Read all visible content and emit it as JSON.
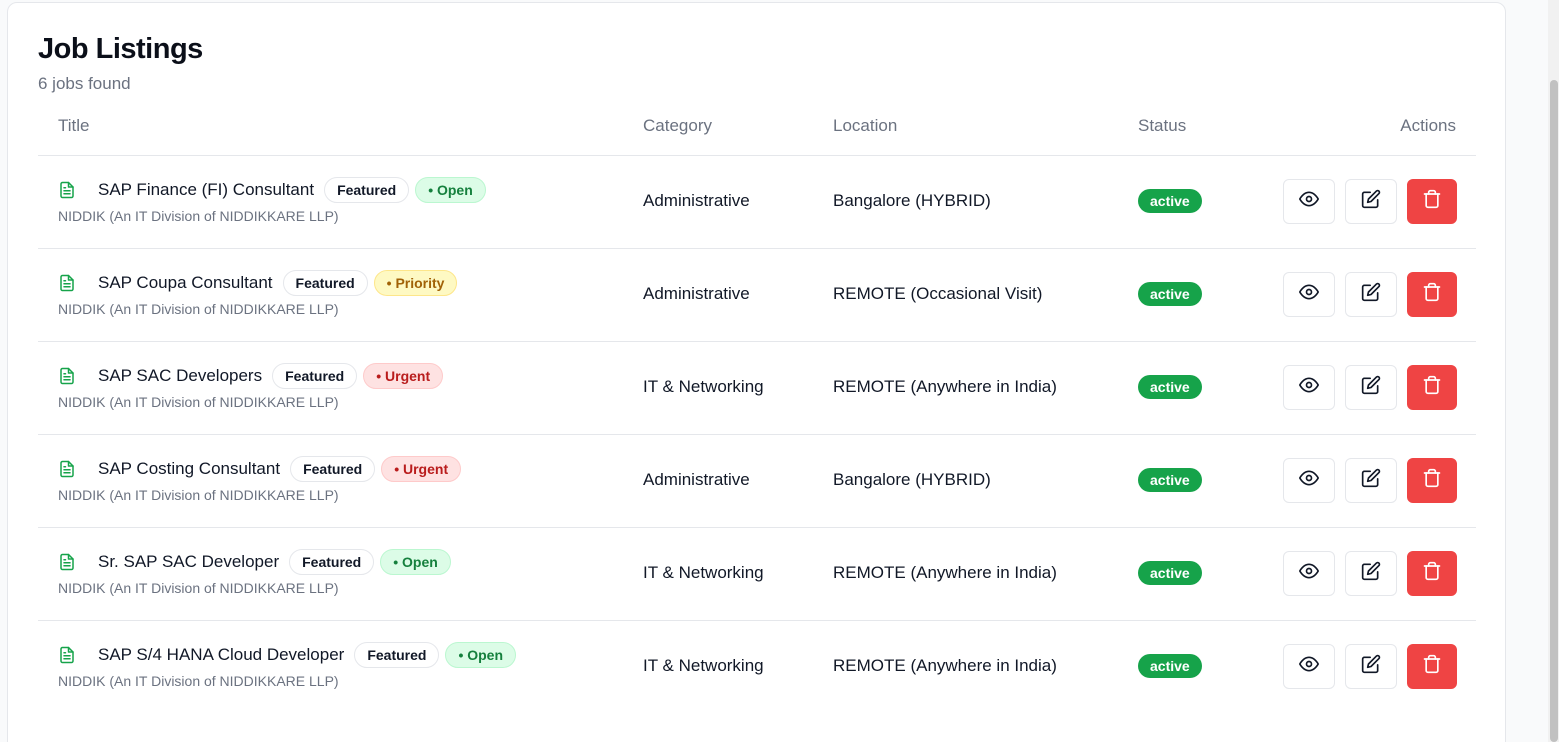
{
  "header": {
    "title": "Job Listings",
    "subtitle": "6 jobs found"
  },
  "columns": {
    "title": "Title",
    "category": "Category",
    "location": "Location",
    "status": "Status",
    "actions": "Actions"
  },
  "colors": {
    "status_active": "#16a34a",
    "delete": "#ef4444",
    "doc_icon": "#16a34a"
  },
  "jobs": [
    {
      "title": "SAP Finance (FI) Consultant",
      "featured": "Featured",
      "tag": "• Open",
      "tag_kind": "open",
      "company": "NIDDIK (An IT Division of NIDDIKKARE LLP)",
      "category": "Administrative",
      "location": "Bangalore (HYBRID)",
      "status": "active"
    },
    {
      "title": "SAP Coupa Consultant",
      "featured": "Featured",
      "tag": "• Priority",
      "tag_kind": "priority",
      "company": "NIDDIK (An IT Division of NIDDIKKARE LLP)",
      "category": "Administrative",
      "location": "REMOTE (Occasional Visit)",
      "status": "active"
    },
    {
      "title": "SAP SAC Developers",
      "featured": "Featured",
      "tag": "• Urgent",
      "tag_kind": "urgent",
      "company": "NIDDIK (An IT Division of NIDDIKKARE LLP)",
      "category": "IT & Networking",
      "location": "REMOTE (Anywhere in India)",
      "status": "active"
    },
    {
      "title": "SAP Costing Consultant",
      "featured": "Featured",
      "tag": "• Urgent",
      "tag_kind": "urgent",
      "company": "NIDDIK (An IT Division of NIDDIKKARE LLP)",
      "category": "Administrative",
      "location": "Bangalore (HYBRID)",
      "status": "active"
    },
    {
      "title": "Sr. SAP SAC Developer",
      "featured": "Featured",
      "tag": "• Open",
      "tag_kind": "open",
      "company": "NIDDIK (An IT Division of NIDDIKKARE LLP)",
      "category": "IT & Networking",
      "location": "REMOTE (Anywhere in India)",
      "status": "active"
    },
    {
      "title": "SAP S/4 HANA Cloud Developer",
      "featured": "Featured",
      "tag": "• Open",
      "tag_kind": "open",
      "company": "NIDDIK (An IT Division of NIDDIKKARE LLP)",
      "category": "IT & Networking",
      "location": "REMOTE (Anywhere in India)",
      "status": "active"
    }
  ],
  "icons": {
    "row_icon": "document-icon",
    "view": "eye-icon",
    "edit": "edit-icon",
    "delete": "trash-icon"
  }
}
